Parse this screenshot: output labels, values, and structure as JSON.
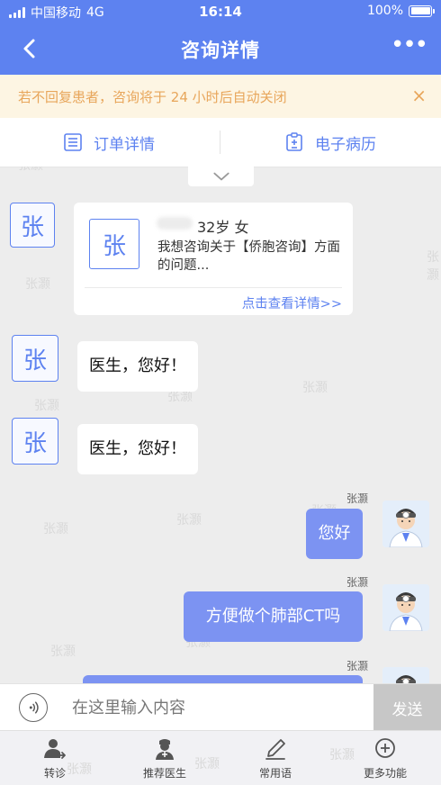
{
  "status_bar": {
    "carrier": "中国移动",
    "network": "4G",
    "time": "16:14",
    "battery": "100%"
  },
  "nav": {
    "title": "咨询详情",
    "more": "•••"
  },
  "notice": {
    "text": "若不回复患者，咨询将于 24 小时后自动关闭",
    "close": "×"
  },
  "tabs": {
    "order_details": "订单详情",
    "medical_record": "电子病历"
  },
  "consult_card": {
    "avatar_char": "张",
    "age_gender": "32岁 女",
    "description": "我想咨询关于【侨胞咨询】方面的问题...",
    "link": "点击查看详情>>"
  },
  "messages": {
    "patient_avatar_char": "张",
    "patient_1": "医生，您好！",
    "patient_2": "医生，您好！",
    "doctor_sender": "张灏",
    "doctor_1": "您好",
    "doctor_2": "方便做个肺部CT吗"
  },
  "watermark": "张灏",
  "input": {
    "placeholder": "在这里输入内容",
    "send": "发送"
  },
  "toolbar": {
    "transfer": "转诊",
    "recommend_doctor": "推荐医生",
    "common_phrases": "常用语",
    "more": "更多功能"
  },
  "colors": {
    "primary": "#5d82f0",
    "bubble_right": "#7c93f2",
    "notice_text": "#e8a65b",
    "notice_bg": "#fdf5e3"
  }
}
